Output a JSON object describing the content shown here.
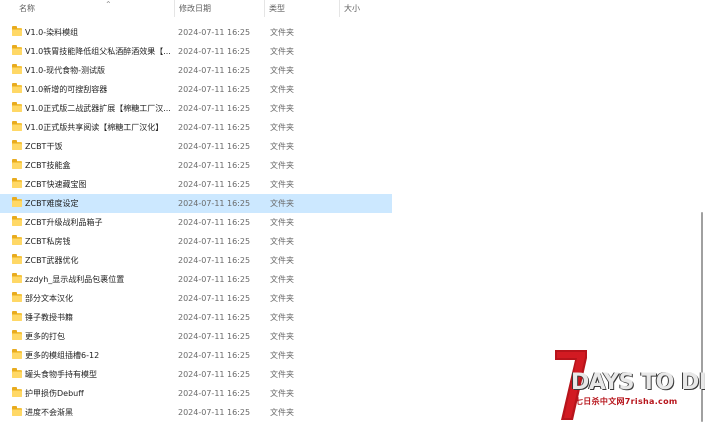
{
  "header": {
    "name": "名称",
    "date": "修改日期",
    "type": "类型",
    "size": "大小"
  },
  "rows": [
    {
      "name": "V1.0-染料模组",
      "date": "2024-07-11 16:25",
      "type": "文件夹"
    },
    {
      "name": "V1.0铁胃技能降低组父私酒醉酒效果【...",
      "date": "2024-07-11 16:25",
      "type": "文件夹"
    },
    {
      "name": "V1.0-现代食物-测试版",
      "date": "2024-07-11 16:25",
      "type": "文件夹"
    },
    {
      "name": "V1.0新增的可搜刮容器",
      "date": "2024-07-11 16:25",
      "type": "文件夹"
    },
    {
      "name": "V1.0正式版二战武器扩展【棉糖工厂汉...",
      "date": "2024-07-11 16:25",
      "type": "文件夹"
    },
    {
      "name": "V1.0正式版共享阅读【棉糖工厂汉化】",
      "date": "2024-07-11 16:25",
      "type": "文件夹"
    },
    {
      "name": "ZCBT干饭",
      "date": "2024-07-11 16:25",
      "type": "文件夹"
    },
    {
      "name": "ZCBT技能盒",
      "date": "2024-07-11 16:25",
      "type": "文件夹"
    },
    {
      "name": "ZCBT快速藏宝图",
      "date": "2024-07-11 16:25",
      "type": "文件夹"
    },
    {
      "name": "ZCBT难度设定",
      "date": "2024-07-11 16:25",
      "type": "文件夹",
      "selected": true
    },
    {
      "name": "ZCBT升级战利品箱子",
      "date": "2024-07-11 16:25",
      "type": "文件夹"
    },
    {
      "name": "ZCBT私房钱",
      "date": "2024-07-11 16:25",
      "type": "文件夹"
    },
    {
      "name": "ZCBT武器优化",
      "date": "2024-07-11 16:25",
      "type": "文件夹"
    },
    {
      "name": "zzdyh_显示战利品包裹位置",
      "date": "2024-07-11 16:25",
      "type": "文件夹"
    },
    {
      "name": "部分文本汉化",
      "date": "2024-07-11 16:25",
      "type": "文件夹"
    },
    {
      "name": "锤子教授书籍",
      "date": "2024-07-11 16:25",
      "type": "文件夹"
    },
    {
      "name": "更多的打包",
      "date": "2024-07-11 16:25",
      "type": "文件夹"
    },
    {
      "name": "更多的模组插槽6-12",
      "date": "2024-07-11 16:25",
      "type": "文件夹"
    },
    {
      "name": "罐头食物手持有模型",
      "date": "2024-07-11 16:25",
      "type": "文件夹"
    },
    {
      "name": "护甲损伤Debuff",
      "date": "2024-07-11 16:25",
      "type": "文件夹"
    },
    {
      "name": "进度不会渐黑",
      "date": "2024-07-11 16:25",
      "type": "文件夹"
    }
  ],
  "watermark": {
    "title": "DAYS TO DIE",
    "subtitle": "七日杀中文网7risha.com",
    "accent": "#b7141b"
  }
}
